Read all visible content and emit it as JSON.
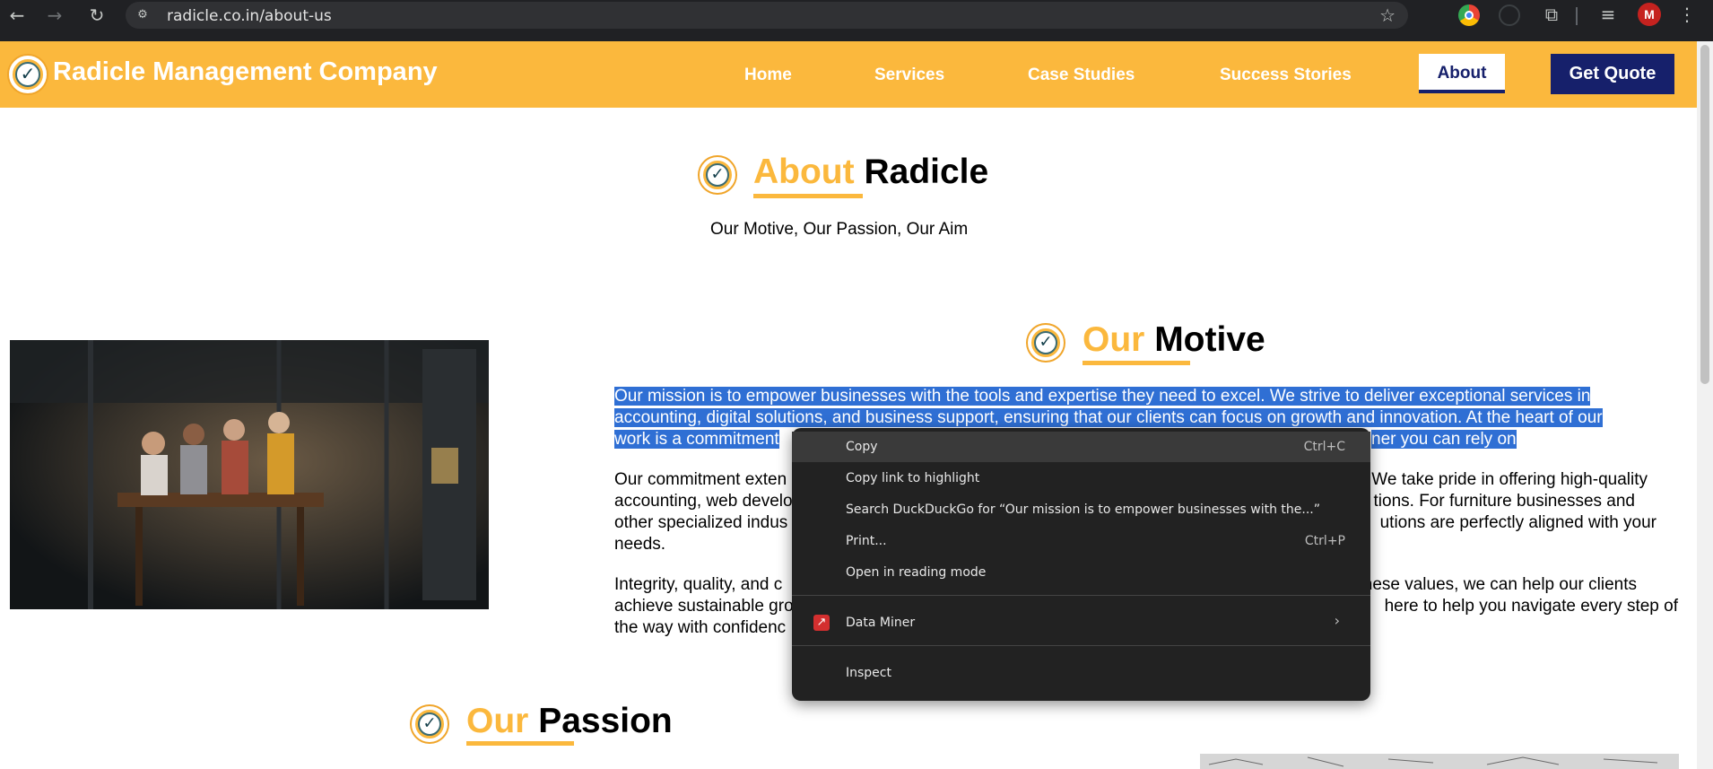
{
  "browser": {
    "url": "radicle.co.in/about-us",
    "avatar_letter": "M"
  },
  "header": {
    "brand": "Radicle Management Company",
    "nav": [
      "Home",
      "Services",
      "Case Studies",
      "Success Stories"
    ],
    "active_nav": "About",
    "cta": "Get Quote"
  },
  "hero": {
    "title_accent": "About",
    "title_plain": "Radicle",
    "subtitle": "Our Motive, Our Passion, Our Aim"
  },
  "motive": {
    "title_accent": "Our",
    "title_plain": "Motive",
    "para1_line1": "Our mission is to empower businesses with the tools and expertise they need to excel. We strive to deliver exceptional services in",
    "para1_line2": "accounting, digital solutions, and business support, ensuring that our clients can focus on growth and innovation. At the heart of our",
    "para1_line3_start": "work is a commitment",
    "para1_line3_end": "ner you can rely on",
    "para2_l1_start": "Our commitment exten",
    "para2_l1_end": "We take pride in offering high-quality",
    "para2_l2_start": "accounting, web develo",
    "para2_l2_end": "tions. For furniture businesses and",
    "para2_l3_start": "other specialized indus",
    "para2_l3_end": "utions are perfectly aligned with your",
    "para2_l4": "needs.",
    "para3_l1_start": "Integrity, quality, and c",
    "para3_l1_end": "n these values, we can help our clients",
    "para3_l2_start": "achieve sustainable gro",
    "para3_l2_end": "here to help you navigate every step of",
    "para3_l3": "the way with confidenc"
  },
  "passion": {
    "title_accent": "Our",
    "title_plain": "Passion"
  },
  "context_menu": {
    "copy": "Copy",
    "copy_shortcut": "Ctrl+C",
    "copy_link": "Copy link to highlight",
    "search": "Search DuckDuckGo for “Our mission is to empower businesses with the...”",
    "print": "Print...",
    "print_shortcut": "Ctrl+P",
    "reading_mode": "Open in reading mode",
    "data_miner": "Data Miner",
    "inspect": "Inspect"
  },
  "colors": {
    "brand_yellow": "#fbb83d",
    "navy": "#16206b",
    "selection": "#2f6fd4",
    "chrome_dark": "#202124"
  }
}
